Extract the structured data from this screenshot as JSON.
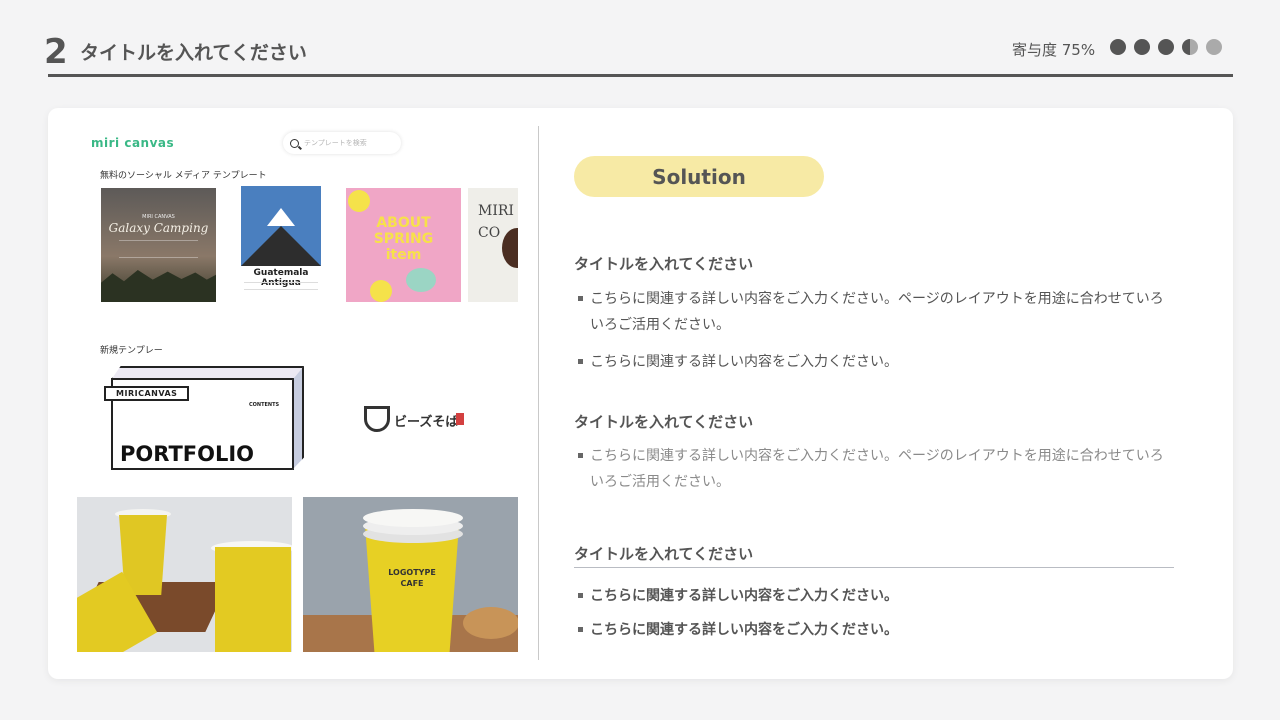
{
  "header": {
    "number": "2",
    "title": "タイトルを入れてください",
    "contribution": "寄与度 75%",
    "contribution_level": 0.75
  },
  "screenshot": {
    "logo": "miri canvas",
    "search_placeholder": "テンプレートを検索",
    "social_section": "無料のソーシャル メディア テンプレート",
    "new_section": "新規テンプレー",
    "templates": {
      "galaxy_title": "Galaxy Camping",
      "galaxy_small": "MIRI CANVAS",
      "guatemala": "Guatemala Antigua",
      "spring_line1": "ABOUT",
      "spring_line2": "SPRING",
      "spring_line3": "item",
      "miri_line1": "MIRI",
      "miri_line2": "CO",
      "portfolio_badge": "MIRICANVAS",
      "portfolio_contents": "CONTENTS",
      "portfolio_title": "PORTFOLIO",
      "soba_name": "ビーズそば",
      "cafe_label": "LOGOTYPE CAFE"
    }
  },
  "solution": {
    "label": "Solution",
    "sections": [
      {
        "title": "タイトルを入れてください",
        "bullets": [
          "こちらに関連する詳しい内容をご入力ください。ページのレイアウトを用途に合わせていろいろご活用ください。",
          "こちらに関連する詳しい内容をご入力ください。"
        ]
      },
      {
        "title": "タイトルを入れてください",
        "bullets": [
          "こちらに関連する詳しい内容をご入力ください。ページのレイアウトを用途に合わせていろいろご活用ください。"
        ]
      },
      {
        "title": "タイトルを入れてください",
        "bullets": [
          "こちらに関連する詳しい内容をご入力ください。",
          "こちらに関連する詳しい内容をご入力ください。"
        ]
      }
    ]
  }
}
